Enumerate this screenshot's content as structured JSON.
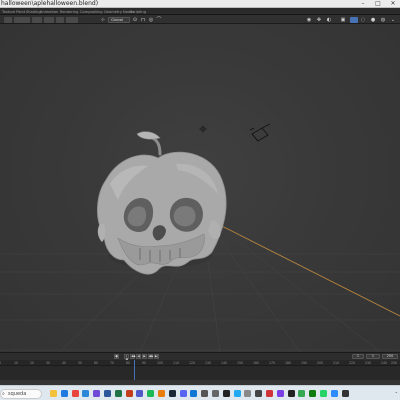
{
  "window": {
    "title": "halloween\\aplehalloween.blend)"
  },
  "workspaces": [
    {
      "label": "Shading",
      "active": false
    },
    {
      "label": "Animation",
      "active": false
    },
    {
      "label": "Rendering",
      "active": false
    },
    {
      "label": "Compositing",
      "active": false
    },
    {
      "label": "Geometry Nodes",
      "active": false
    },
    {
      "label": "Scripting",
      "active": false
    }
  ],
  "first_tab": "Texture Paint",
  "toolbar": {
    "transform_orientation": "Global"
  },
  "timeline": {
    "current_frame": "1",
    "start": "1",
    "end": "250",
    "ticks": [
      "0",
      "10",
      "20",
      "30",
      "40",
      "50",
      "60",
      "70",
      "80",
      "90",
      "100",
      "110",
      "120",
      "130",
      "140",
      "150",
      "160",
      "170",
      "180",
      "190",
      "200",
      "210",
      "220",
      "230",
      "240",
      "250"
    ]
  },
  "taskbar": {
    "search_label": "squeda",
    "apps": [
      "file-explorer",
      "edge",
      "chrome",
      "mail",
      "photos",
      "word",
      "excel",
      "powerpoint",
      "teams",
      "spotify",
      "blender",
      "steam",
      "discord",
      "onedrive",
      "store",
      "settings",
      "terminal",
      "vscode",
      "notepad",
      "calculator",
      "paint",
      "clipchamp",
      "camera",
      "maps",
      "xbox",
      "whatsapp",
      "zoom",
      "obs"
    ]
  },
  "colors": {
    "viewport_bg": "#3a3a3a",
    "model": "#a9a9a9",
    "x_axis": "#c58a3c",
    "playhead": "#4772b3"
  }
}
